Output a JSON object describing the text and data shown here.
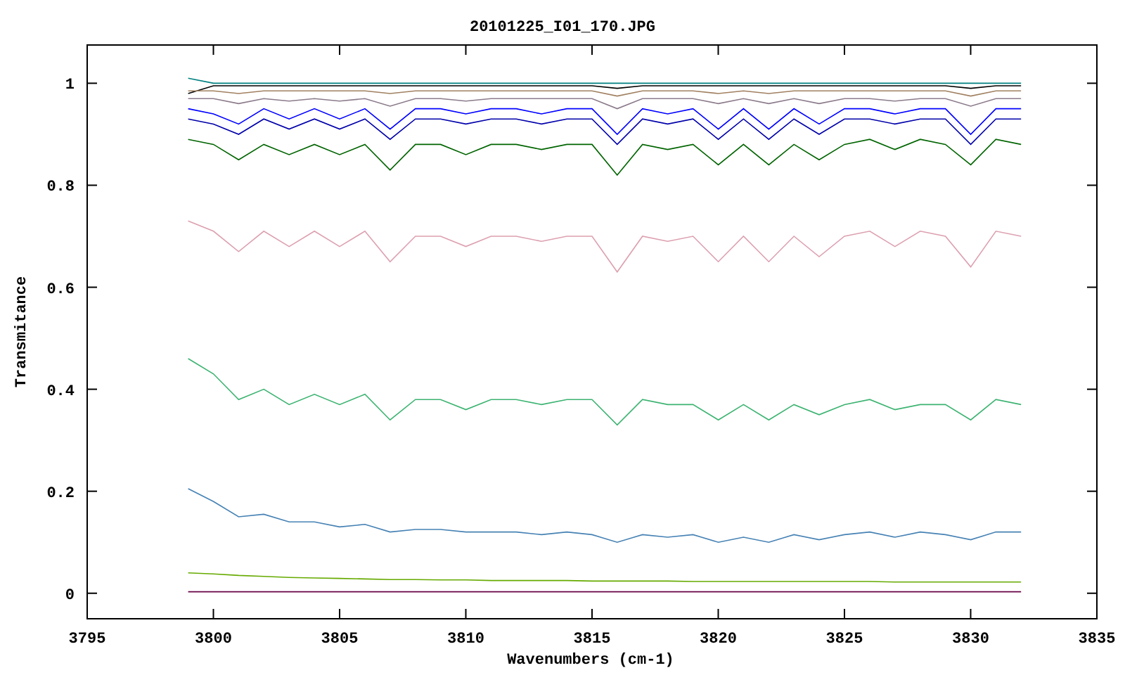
{
  "chart_data": {
    "type": "line",
    "title": "20101225_I01_170.JPG",
    "xlabel": "Wavenumbers (cm-1)",
    "ylabel": "Transmitance",
    "xlim": [
      3795,
      3835
    ],
    "ylim": [
      -0.05,
      1.075
    ],
    "xticks": [
      3795,
      3800,
      3805,
      3810,
      3815,
      3820,
      3825,
      3830,
      3835
    ],
    "yticks": [
      0,
      0.2,
      0.4,
      0.6,
      0.8,
      1
    ],
    "x": [
      3799,
      3800,
      3801,
      3802,
      3803,
      3804,
      3805,
      3806,
      3807,
      3808,
      3809,
      3810,
      3811,
      3812,
      3813,
      3814,
      3815,
      3816,
      3817,
      3818,
      3819,
      3820,
      3821,
      3822,
      3823,
      3824,
      3825,
      3826,
      3827,
      3828,
      3829,
      3830,
      3831,
      3832
    ],
    "series": [
      {
        "color": "#008080",
        "values": [
          1.01,
          1,
          1,
          1,
          1,
          1,
          1,
          1,
          1,
          1,
          1,
          1,
          1,
          1,
          1,
          1,
          1,
          1,
          1,
          1,
          1,
          1,
          1,
          1,
          1,
          1,
          1,
          1,
          1,
          1,
          1,
          1,
          1,
          1
        ]
      },
      {
        "color": "#000000",
        "values": [
          0.98,
          0.995,
          0.995,
          0.995,
          0.995,
          0.995,
          0.995,
          0.995,
          0.995,
          0.995,
          0.995,
          0.995,
          0.995,
          0.995,
          0.995,
          0.995,
          0.995,
          0.99,
          0.995,
          0.995,
          0.995,
          0.995,
          0.995,
          0.995,
          0.995,
          0.995,
          0.995,
          0.995,
          0.995,
          0.995,
          0.995,
          0.99,
          0.995,
          0.995
        ]
      },
      {
        "color": "#a08060",
        "values": [
          0.985,
          0.985,
          0.98,
          0.985,
          0.985,
          0.985,
          0.985,
          0.985,
          0.98,
          0.985,
          0.985,
          0.985,
          0.985,
          0.985,
          0.985,
          0.985,
          0.985,
          0.975,
          0.985,
          0.985,
          0.985,
          0.98,
          0.985,
          0.98,
          0.985,
          0.985,
          0.985,
          0.985,
          0.985,
          0.985,
          0.985,
          0.975,
          0.985,
          0.985
        ]
      },
      {
        "color": "#8b7b8b",
        "values": [
          0.97,
          0.97,
          0.96,
          0.97,
          0.965,
          0.97,
          0.965,
          0.97,
          0.955,
          0.97,
          0.97,
          0.965,
          0.97,
          0.97,
          0.97,
          0.97,
          0.97,
          0.95,
          0.97,
          0.97,
          0.97,
          0.96,
          0.97,
          0.96,
          0.97,
          0.96,
          0.97,
          0.97,
          0.965,
          0.97,
          0.97,
          0.955,
          0.97,
          0.97
        ]
      },
      {
        "color": "#0000ff",
        "values": [
          0.95,
          0.94,
          0.92,
          0.95,
          0.93,
          0.95,
          0.93,
          0.95,
          0.91,
          0.95,
          0.95,
          0.94,
          0.95,
          0.95,
          0.94,
          0.95,
          0.95,
          0.9,
          0.95,
          0.94,
          0.95,
          0.91,
          0.95,
          0.91,
          0.95,
          0.92,
          0.95,
          0.95,
          0.94,
          0.95,
          0.95,
          0.9,
          0.95,
          0.95
        ]
      },
      {
        "color": "#0000aa",
        "values": [
          0.93,
          0.92,
          0.9,
          0.93,
          0.91,
          0.93,
          0.91,
          0.93,
          0.89,
          0.93,
          0.93,
          0.92,
          0.93,
          0.93,
          0.92,
          0.93,
          0.93,
          0.88,
          0.93,
          0.92,
          0.93,
          0.89,
          0.93,
          0.89,
          0.93,
          0.9,
          0.93,
          0.93,
          0.92,
          0.93,
          0.93,
          0.88,
          0.93,
          0.93
        ]
      },
      {
        "color": "#006400",
        "values": [
          0.89,
          0.88,
          0.85,
          0.88,
          0.86,
          0.88,
          0.86,
          0.88,
          0.83,
          0.88,
          0.88,
          0.86,
          0.88,
          0.88,
          0.87,
          0.88,
          0.88,
          0.82,
          0.88,
          0.87,
          0.88,
          0.84,
          0.88,
          0.84,
          0.88,
          0.85,
          0.88,
          0.89,
          0.87,
          0.89,
          0.88,
          0.84,
          0.89,
          0.88
        ]
      },
      {
        "color": "#dda0b0",
        "values": [
          0.73,
          0.71,
          0.67,
          0.71,
          0.68,
          0.71,
          0.68,
          0.71,
          0.65,
          0.7,
          0.7,
          0.68,
          0.7,
          0.7,
          0.69,
          0.7,
          0.7,
          0.63,
          0.7,
          0.69,
          0.7,
          0.65,
          0.7,
          0.65,
          0.7,
          0.66,
          0.7,
          0.71,
          0.68,
          0.71,
          0.7,
          0.64,
          0.71,
          0.7
        ]
      },
      {
        "color": "#3cb371",
        "values": [
          0.46,
          0.43,
          0.38,
          0.4,
          0.37,
          0.39,
          0.37,
          0.39,
          0.34,
          0.38,
          0.38,
          0.36,
          0.38,
          0.38,
          0.37,
          0.38,
          0.38,
          0.33,
          0.38,
          0.37,
          0.37,
          0.34,
          0.37,
          0.34,
          0.37,
          0.35,
          0.37,
          0.38,
          0.36,
          0.37,
          0.37,
          0.34,
          0.38,
          0.37
        ]
      },
      {
        "color": "#4682b4",
        "values": [
          0.205,
          0.18,
          0.15,
          0.155,
          0.14,
          0.14,
          0.13,
          0.135,
          0.12,
          0.125,
          0.125,
          0.12,
          0.12,
          0.12,
          0.115,
          0.12,
          0.115,
          0.1,
          0.115,
          0.11,
          0.115,
          0.1,
          0.11,
          0.1,
          0.115,
          0.105,
          0.115,
          0.12,
          0.11,
          0.12,
          0.115,
          0.105,
          0.12,
          0.12
        ]
      },
      {
        "color": "#66aa00",
        "values": [
          0.04,
          0.038,
          0.035,
          0.033,
          0.031,
          0.03,
          0.029,
          0.028,
          0.027,
          0.027,
          0.026,
          0.026,
          0.025,
          0.025,
          0.025,
          0.025,
          0.024,
          0.024,
          0.024,
          0.024,
          0.023,
          0.023,
          0.023,
          0.023,
          0.023,
          0.023,
          0.023,
          0.023,
          0.022,
          0.022,
          0.022,
          0.022,
          0.022,
          0.022
        ]
      },
      {
        "color": "#660044",
        "values": [
          0.003,
          0.003,
          0.003,
          0.003,
          0.003,
          0.003,
          0.003,
          0.003,
          0.003,
          0.003,
          0.003,
          0.003,
          0.003,
          0.003,
          0.003,
          0.003,
          0.003,
          0.003,
          0.003,
          0.003,
          0.003,
          0.003,
          0.003,
          0.003,
          0.003,
          0.003,
          0.003,
          0.003,
          0.003,
          0.003,
          0.003,
          0.003,
          0.003,
          0.003
        ]
      }
    ]
  }
}
